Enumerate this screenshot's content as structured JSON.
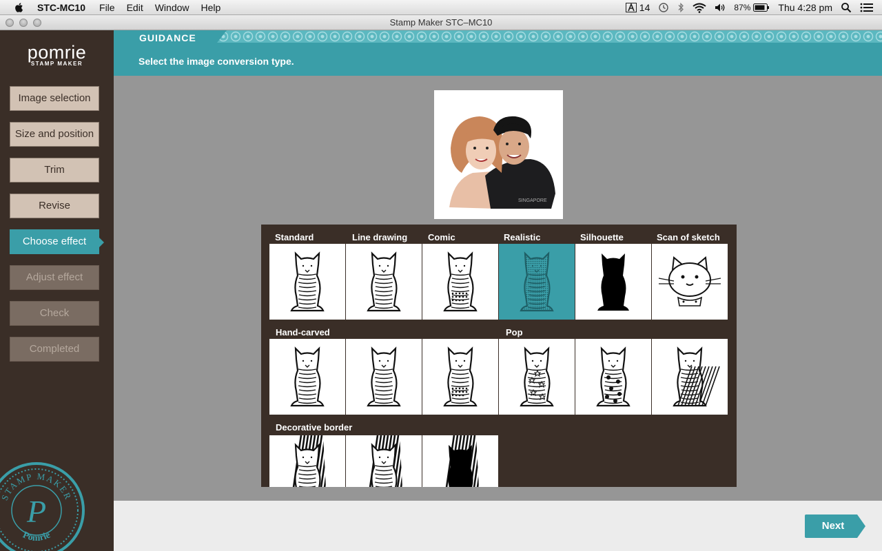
{
  "menubar": {
    "app_name": "STC-MC10",
    "menus": [
      "File",
      "Edit",
      "Window",
      "Help"
    ],
    "adobe_count": "14",
    "battery": "87%",
    "clock": "Thu 4:28 pm"
  },
  "window": {
    "title": "Stamp Maker STC–MC10"
  },
  "sidebar": {
    "brand": "pomrie",
    "brand_sub": "STAMP MAKER",
    "steps": [
      {
        "label": "Image selection",
        "state": "enabled"
      },
      {
        "label": "Size and position",
        "state": "enabled"
      },
      {
        "label": "Trim",
        "state": "enabled"
      },
      {
        "label": "Revise",
        "state": "enabled"
      },
      {
        "label": "Choose effect",
        "state": "active"
      },
      {
        "label": "Adjust effect",
        "state": "disabled"
      },
      {
        "label": "Check",
        "state": "disabled"
      },
      {
        "label": "Completed",
        "state": "disabled"
      }
    ],
    "seal": {
      "ring_text": "STAMP MAKER",
      "letter": "P",
      "bottom_text": "Pomrie"
    }
  },
  "guidance": {
    "tab_label": "GUIDANCE",
    "message": "Select the image conversion type."
  },
  "effects": {
    "labels": {
      "standard": "Standard",
      "line_drawing": "Line drawing",
      "comic": "Comic",
      "realistic": "Realistic",
      "silhouette": "Silhouette",
      "scan_of_sketch": "Scan of sketch",
      "hand_carved": "Hand-carved",
      "pop": "Pop",
      "decorative_border": "Decorative border"
    },
    "selected": "realistic"
  },
  "footer": {
    "next_label": "Next"
  },
  "colors": {
    "accent": "#3a9ea8",
    "sidebar_bg": "#3a2e27",
    "button_bg": "#d2c2b4",
    "content_bg": "#969696"
  }
}
